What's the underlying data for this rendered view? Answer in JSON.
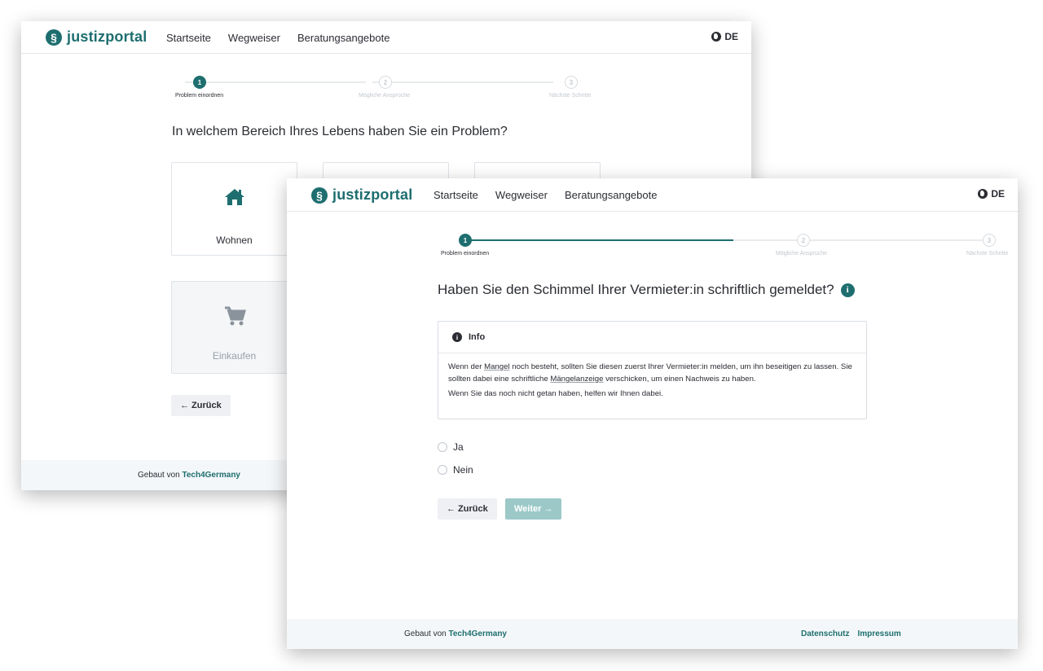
{
  "brand": {
    "name": "justizportal",
    "mark": "§"
  },
  "nav": {
    "links": [
      "Startseite",
      "Wegweiser",
      "Beratungsangebote"
    ],
    "language": "DE"
  },
  "steps": [
    {
      "number": "1",
      "label": "Problem einordnen"
    },
    {
      "number": "2",
      "label": "Mögliche Ansprüche"
    },
    {
      "number": "3",
      "label": "Nächste Schritte"
    }
  ],
  "back_screen": {
    "question": "In welchem Bereich Ihres Lebens haben Sie ein Problem?",
    "cards": [
      {
        "label": "Wohnen",
        "icon": "house-icon",
        "enabled": true
      },
      {
        "label": "Einkaufen",
        "icon": "cart-icon",
        "enabled": false
      }
    ],
    "back_button": "← Zurück"
  },
  "front_screen": {
    "question": "Haben Sie den Schimmel Ihrer Vermieter:in schriftlich gemeldet?",
    "info": {
      "title": "Info",
      "para1_a": "Wenn der ",
      "para1_link1": "Mangel",
      "para1_b": " noch besteht, sollten Sie diesen zuerst Ihrer Vermieter:in melden, um ihn beseitigen zu lassen. Sie sollten dabei eine schriftliche ",
      "para1_link2": "Mängelanzeige",
      "para1_c": " verschicken, um einen Nachweis zu haben.",
      "para2": "Wenn Sie das noch nicht getan haben, helfen wir Ihnen dabei."
    },
    "options": [
      "Ja",
      "Nein"
    ],
    "back_button": "← Zurück",
    "next_button": "Weiter →"
  },
  "footer": {
    "built_by_prefix": "Gebaut von ",
    "built_by_name": "Tech4Germany",
    "links": [
      "Datenschutz",
      "Impressum"
    ]
  },
  "colors": {
    "brand": "#1e6e6f",
    "next_disabled": "#9cc9c8",
    "footer_bg": "#f4f7f9"
  }
}
